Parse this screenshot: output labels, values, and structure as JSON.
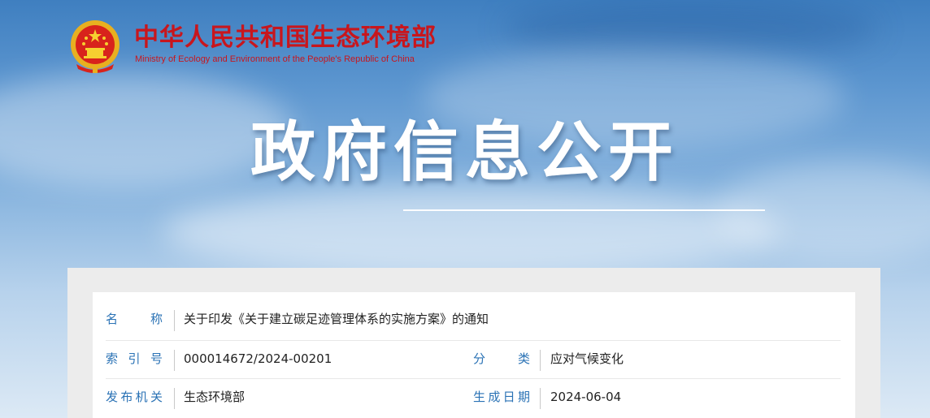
{
  "header": {
    "site_title": "中华人民共和国生态环境部",
    "site_subtitle": "Ministry of Ecology and Environment of the People's Republic of China",
    "emblem_icon": "national-emblem-icon",
    "brand_color": "#c8161d"
  },
  "hero": {
    "title": "政府信息公开"
  },
  "info": {
    "name_label": "名称",
    "name_value": "关于印发《关于建立碳足迹管理体系的实施方案》的通知",
    "index_label": "索引号",
    "index_value": "000014672/2024-00201",
    "category_label": "分类",
    "category_value": "应对气候变化",
    "issuer_label": "发布机关",
    "issuer_value": "生态环境部",
    "date_label": "生成日期",
    "date_value": "2024-06-04",
    "label_color": "#2a72b5"
  }
}
